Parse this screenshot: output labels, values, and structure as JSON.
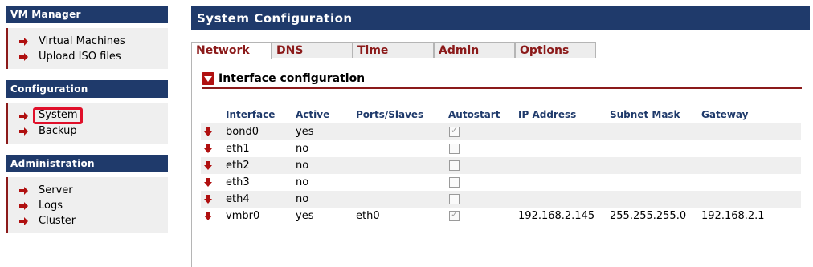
{
  "sidebar": {
    "sections": [
      {
        "title": "VM Manager",
        "items": [
          {
            "label": "Virtual Machines"
          },
          {
            "label": "Upload ISO files"
          }
        ]
      },
      {
        "title": "Configuration",
        "items": [
          {
            "label": "System",
            "selected": true
          },
          {
            "label": "Backup"
          }
        ]
      },
      {
        "title": "Administration",
        "items": [
          {
            "label": "Server"
          },
          {
            "label": "Logs"
          },
          {
            "label": "Cluster"
          }
        ]
      }
    ]
  },
  "main": {
    "title": "System Configuration",
    "tabs": [
      {
        "label": "Network",
        "active": true
      },
      {
        "label": "DNS"
      },
      {
        "label": "Time"
      },
      {
        "label": "Admin"
      },
      {
        "label": "Options"
      }
    ],
    "section_title": "Interface configuration",
    "table": {
      "headers": [
        "Interface",
        "Active",
        "Ports/Slaves",
        "Autostart",
        "IP Address",
        "Subnet Mask",
        "Gateway"
      ],
      "rows": [
        {
          "interface": "bond0",
          "active": "yes",
          "ports": "",
          "autostart": true,
          "ip": "",
          "mask": "",
          "gateway": ""
        },
        {
          "interface": "eth1",
          "active": "no",
          "ports": "",
          "autostart": false,
          "ip": "",
          "mask": "",
          "gateway": ""
        },
        {
          "interface": "eth2",
          "active": "no",
          "ports": "",
          "autostart": false,
          "ip": "",
          "mask": "",
          "gateway": ""
        },
        {
          "interface": "eth3",
          "active": "no",
          "ports": "",
          "autostart": false,
          "ip": "",
          "mask": "",
          "gateway": ""
        },
        {
          "interface": "eth4",
          "active": "no",
          "ports": "",
          "autostart": false,
          "ip": "",
          "mask": "",
          "gateway": ""
        },
        {
          "interface": "vmbr0",
          "active": "yes",
          "ports": "eth0",
          "autostart": true,
          "ip": "192.168.2.145",
          "mask": "255.255.255.0",
          "gateway": "192.168.2.1"
        }
      ]
    }
  },
  "colors": {
    "header_bg": "#1f3a6b",
    "accent": "#8b1a1a",
    "arrow": "#b01010",
    "selection_box": "#e0102a"
  }
}
